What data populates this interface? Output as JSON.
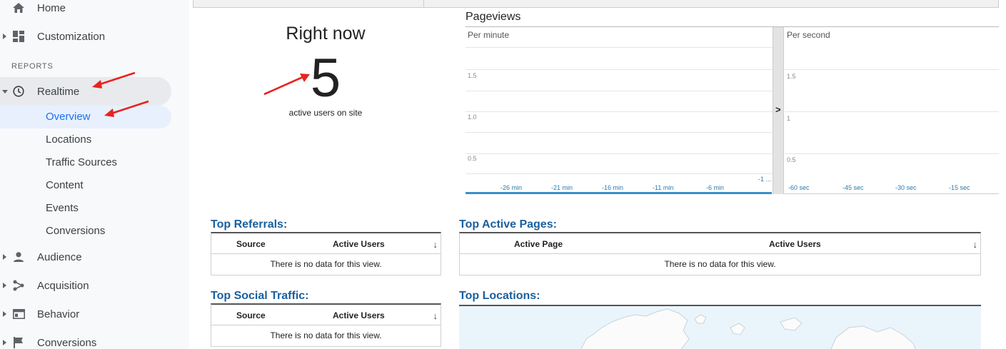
{
  "sidebar": {
    "items": [
      {
        "label": "Home",
        "icon": "home-icon"
      },
      {
        "label": "Customization",
        "icon": "dashboard-icon"
      }
    ],
    "section_label": "REPORTS",
    "realtime": {
      "label": "Realtime",
      "icon": "clock-icon",
      "children": [
        "Overview",
        "Locations",
        "Traffic Sources",
        "Content",
        "Events",
        "Conversions"
      ],
      "active_child": "Overview"
    },
    "bottom_items": [
      {
        "label": "Audience",
        "icon": "person-icon"
      },
      {
        "label": "Acquisition",
        "icon": "acquisition-icon"
      },
      {
        "label": "Behavior",
        "icon": "behavior-icon"
      },
      {
        "label": "Conversions",
        "icon": "flag-icon"
      }
    ]
  },
  "right_now": {
    "title": "Right now",
    "count": "5",
    "subtitle": "active users on site"
  },
  "pageviews": {
    "title": "Pageviews",
    "per_minute": {
      "label": "Per minute",
      "yticks": [
        "1.5",
        "1.0",
        "0.5"
      ],
      "xticks": [
        "-26 min",
        "-21 min",
        "-16 min",
        "-11 min",
        "-6 min",
        "-1 ..."
      ]
    },
    "per_second": {
      "label": "Per second",
      "yticks": [
        "1.5",
        "1",
        "0.5"
      ],
      "xticks": [
        "-60 sec",
        "-45 sec",
        "-30 sec",
        "-15 sec"
      ]
    },
    "expand_glyph": ">"
  },
  "top_referrals": {
    "title": "Top Referrals:",
    "col1": "Source",
    "col2": "Active Users",
    "empty": "There is no data for this view."
  },
  "top_social": {
    "title": "Top Social Traffic:",
    "col1": "Source",
    "col2": "Active Users",
    "empty": "There is no data for this view."
  },
  "top_pages": {
    "title": "Top Active Pages:",
    "col1": "Active Page",
    "col2": "Active Users",
    "empty": "There is no data for this view."
  },
  "top_locations": {
    "title": "Top Locations:"
  },
  "colors": {
    "accent": "#1a73e8",
    "title_blue": "#1a5f9e",
    "annotation_red": "#e8231f"
  }
}
